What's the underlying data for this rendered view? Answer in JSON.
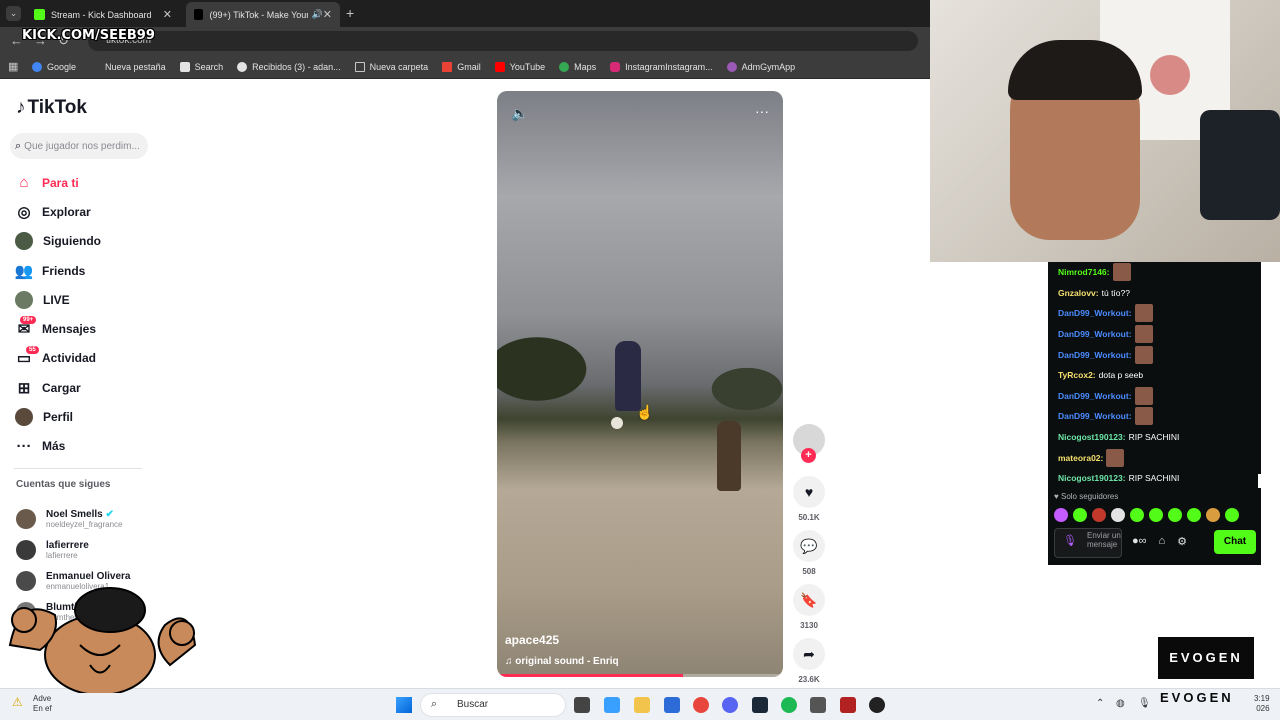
{
  "overlay": {
    "kick_url": "KICK.COM/SEEB99",
    "evogen_top": "EVOGEN",
    "evogen_bottom": "EVOGEN"
  },
  "browser": {
    "tabs": [
      {
        "label": "Stream - Kick Dashboard",
        "active": false
      },
      {
        "label": "(99+) TikTok - Make Your Da",
        "active": true
      }
    ],
    "new_tab": "+",
    "url": "tiktok.com",
    "bookmarks": [
      "Google",
      "Nueva pestaña",
      "Search",
      "Recibidos (3) - adan...",
      "Nueva carpeta",
      "Gmail",
      "YouTube",
      "Maps",
      "InstagramInstagram...",
      "AdmGymApp"
    ]
  },
  "tiktok": {
    "logo": "TikTok",
    "search_placeholder": "Que jugador nos perdim...",
    "nav": [
      {
        "label": "Para ti",
        "icon": "home-icon",
        "active": true
      },
      {
        "label": "Explorar",
        "icon": "compass-icon"
      },
      {
        "label": "Siguiendo",
        "icon": "avatar-icon"
      },
      {
        "label": "Friends",
        "icon": "friends-icon"
      },
      {
        "label": "LIVE",
        "icon": "live-icon"
      },
      {
        "label": "Mensajes",
        "icon": "message-icon",
        "badge": "99+"
      },
      {
        "label": "Actividad",
        "icon": "activity-icon",
        "badge": "55"
      },
      {
        "label": "Cargar",
        "icon": "upload-icon"
      },
      {
        "label": "Perfil",
        "icon": "profile-icon"
      },
      {
        "label": "Más",
        "icon": "more-icon"
      }
    ],
    "following_title": "Cuentas que sigues",
    "following": [
      {
        "name": "Noel Smells",
        "user": "noeldeyzel_fragrance",
        "verified": true
      },
      {
        "name": "lafierrere",
        "user": "lafierrere"
      },
      {
        "name": "Enmanuel Olivera",
        "user": "enmanuelolivera1"
      },
      {
        "name": "Blumthew",
        "user": "blumthew"
      }
    ],
    "video": {
      "author": "apace425",
      "sound": "original sound - Enriq",
      "progress": 0.65
    },
    "actions": {
      "likes": "50.1K",
      "comments": "508",
      "saves": "3130",
      "shares": "23.6K"
    }
  },
  "chat": {
    "messages": [
      {
        "user": "Nimrod7146:",
        "color": "green",
        "text": "",
        "emote": true
      },
      {
        "user": "Gnzalovv:",
        "color": "yellow",
        "text": "tú tío??",
        "emote": false
      },
      {
        "user": "DanD99_Workout:",
        "color": "blue",
        "text": "",
        "emote": true
      },
      {
        "user": "DanD99_Workout:",
        "color": "blue",
        "text": "",
        "emote": true
      },
      {
        "user": "DanD99_Workout:",
        "color": "blue",
        "text": "",
        "emote": true
      },
      {
        "user": "TyRcox2:",
        "color": "yellow",
        "text": "dota p seeb",
        "emote": false
      },
      {
        "user": "DanD99_Workout:",
        "color": "blue",
        "text": "",
        "emote": true
      },
      {
        "user": "DanD99_Workout:",
        "color": "blue",
        "text": "",
        "emote": true
      },
      {
        "user": "Nicogost190123:",
        "color": "teal",
        "text": "RIP SACHINI",
        "emote": false
      },
      {
        "user": "mateora02:",
        "color": "yellow",
        "text": "",
        "emote": true
      },
      {
        "user": "Nicogost190123:",
        "color": "teal",
        "text": "RIP SACHINI",
        "emote": false
      }
    ],
    "mode": "Solo seguidores",
    "input_placeholder": "Enviar un mensaje",
    "send_label": "Chat"
  },
  "taskbar": {
    "search_label": "Buscar",
    "notice_line1": "Adve",
    "notice_line2": "En ef",
    "time": "3:19",
    "date": "026"
  },
  "colors": {
    "tiktok_accent": "#fe2c55",
    "kick_green": "#53fc18"
  }
}
